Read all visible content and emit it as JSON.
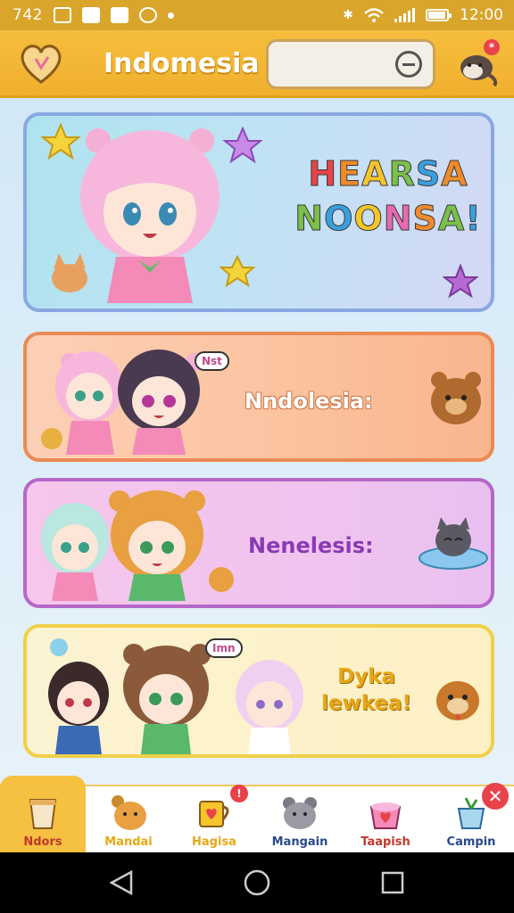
{
  "status_bar": {
    "left_text": "742",
    "time": "12:00",
    "battery_level": 0.85
  },
  "header": {
    "title": "Indomesia",
    "search_placeholder": "",
    "notification_badge": "*"
  },
  "cards": [
    {
      "title_line1": [
        "H",
        "E",
        "A",
        "R",
        "S",
        "A"
      ],
      "title_line2": [
        "N",
        "O",
        "O",
        "N",
        "S",
        "A",
        "!"
      ],
      "title_colors1": [
        "#e8424a",
        "#f08a2a",
        "#f5c52a",
        "#7ac04a",
        "#3aa0e0",
        "#f08a2a"
      ],
      "title_colors2": [
        "#7ac04a",
        "#3aa0e0",
        "#f5c52a",
        "#e86ab0",
        "#f08a2a",
        "#7ac04a",
        "#3aa0e0"
      ]
    },
    {
      "label": "Nndolesia:",
      "bubble": "Nst"
    },
    {
      "label": "Nenelesis:"
    },
    {
      "label_line1": "Dyka",
      "label_line2": "lewkea!",
      "bubble": "Imn"
    }
  ],
  "bottom_nav": [
    {
      "label": "Ndors",
      "color": "#c0392b",
      "icon": "cup-icon",
      "active": true
    },
    {
      "label": "Mandai",
      "color": "#e8a716",
      "icon": "bear-icon",
      "active": false
    },
    {
      "label": "Hagisa",
      "color": "#e8a716",
      "icon": "mug-icon",
      "active": false,
      "badge": "!"
    },
    {
      "label": "Mangain",
      "color": "#2a4a8a",
      "icon": "cat-icon",
      "active": false
    },
    {
      "label": "Taapish",
      "color": "#c0392b",
      "icon": "pot-icon",
      "active": false
    },
    {
      "label": "Campin",
      "color": "#2a4a8a",
      "icon": "plant-icon",
      "active": false,
      "close": "✕"
    }
  ]
}
